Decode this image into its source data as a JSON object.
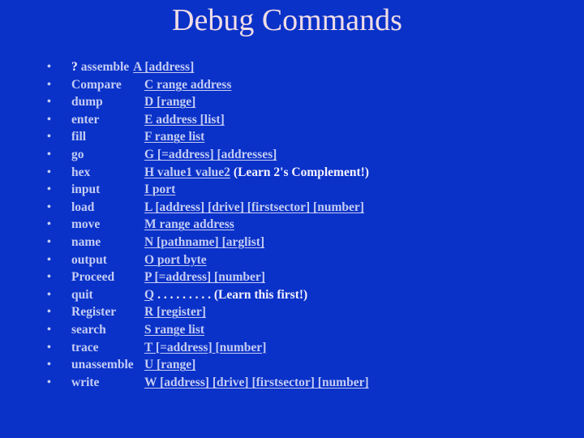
{
  "title": "Debug Commands",
  "items": [
    {
      "prefix": "?",
      "name": "assemble",
      "syntax": "A [address]",
      "note": ""
    },
    {
      "prefix": "",
      "name": "Compare",
      "syntax": "C range address",
      "note": ""
    },
    {
      "prefix": "",
      "name": "dump",
      "syntax": "D [range]",
      "note": ""
    },
    {
      "prefix": "",
      "name": "enter",
      "syntax": "E address [list]",
      "note": ""
    },
    {
      "prefix": "",
      "name": "fill",
      "syntax": "F range list",
      "note": ""
    },
    {
      "prefix": "",
      "name": "go",
      "syntax": "G [=address] [addresses]",
      "note": ""
    },
    {
      "prefix": "",
      "name": "hex",
      "syntax": "H value1 value2",
      "note": "(Learn 2's Complement!)"
    },
    {
      "prefix": "",
      "name": "input",
      "syntax": "I port",
      "note": ""
    },
    {
      "prefix": "",
      "name": "load",
      "syntax": "L [address] [drive] [firstsector] [number]",
      "note": ""
    },
    {
      "prefix": "",
      "name": "move",
      "syntax": "M range address",
      "note": ""
    },
    {
      "prefix": "",
      "name": "name",
      "syntax": "N [pathname] [arglist]",
      "note": ""
    },
    {
      "prefix": "",
      "name": "output",
      "syntax": "O port byte",
      "note": ""
    },
    {
      "prefix": "",
      "name": "Proceed",
      "syntax": "P [=address] [number]",
      "note": ""
    },
    {
      "prefix": "",
      "name": "quit",
      "syntax": "Q",
      "note": ". . . . . . . . . (Learn this first!)"
    },
    {
      "prefix": "",
      "name": "Register",
      "syntax": "R [register]",
      "note": ""
    },
    {
      "prefix": "",
      "name": "search",
      "syntax": "S range list",
      "note": ""
    },
    {
      "prefix": "",
      "name": "trace",
      "syntax": "T [=address] [number]",
      "note": ""
    },
    {
      "prefix": "",
      "name": "unassemble",
      "syntax": "U [range]",
      "note": ""
    },
    {
      "prefix": "",
      "name": "write",
      "syntax": "W [address] [drive] [firstsector] [number]",
      "note": ""
    }
  ],
  "bullet_glyph": "•"
}
